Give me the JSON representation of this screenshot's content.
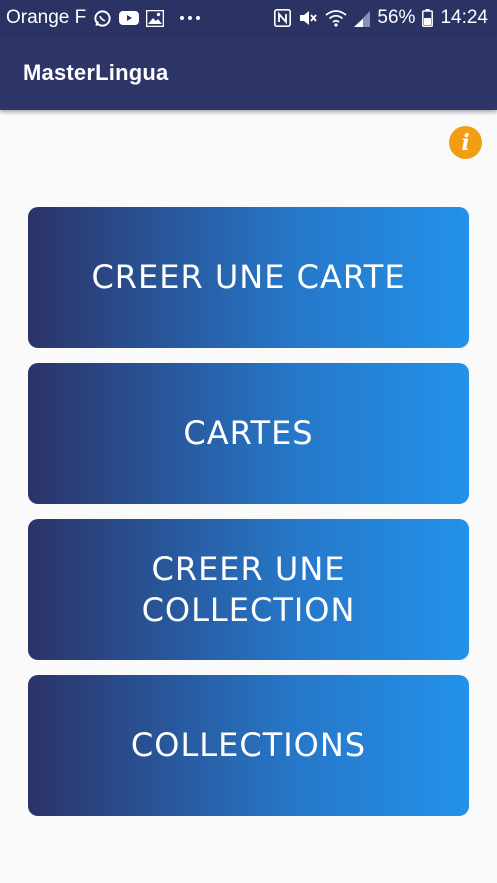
{
  "status_bar": {
    "carrier": "Orange F",
    "battery": "56%",
    "time": "14:24",
    "icons_left": [
      "whatsapp-icon",
      "youtube-icon",
      "gallery-icon",
      "more-dots-icon"
    ],
    "icons_right": [
      "nfc-icon",
      "mute-icon",
      "wifi-icon",
      "signal-icon",
      "battery-icon"
    ]
  },
  "app_bar": {
    "title": "MasterLingua"
  },
  "info_button": {
    "icon": "info-icon",
    "glyph": "i",
    "color": "#f29d12"
  },
  "menu": {
    "buttons": [
      {
        "label": "CREER UNE CARTE"
      },
      {
        "label": "CARTES"
      },
      {
        "label": "CREER UNE COLLECTION"
      },
      {
        "label": "COLLECTIONS"
      }
    ]
  },
  "colors": {
    "app_bar": "#2e3569",
    "gradient_start": "#2b3368",
    "gradient_end": "#2392ea",
    "accent": "#f29d12"
  }
}
